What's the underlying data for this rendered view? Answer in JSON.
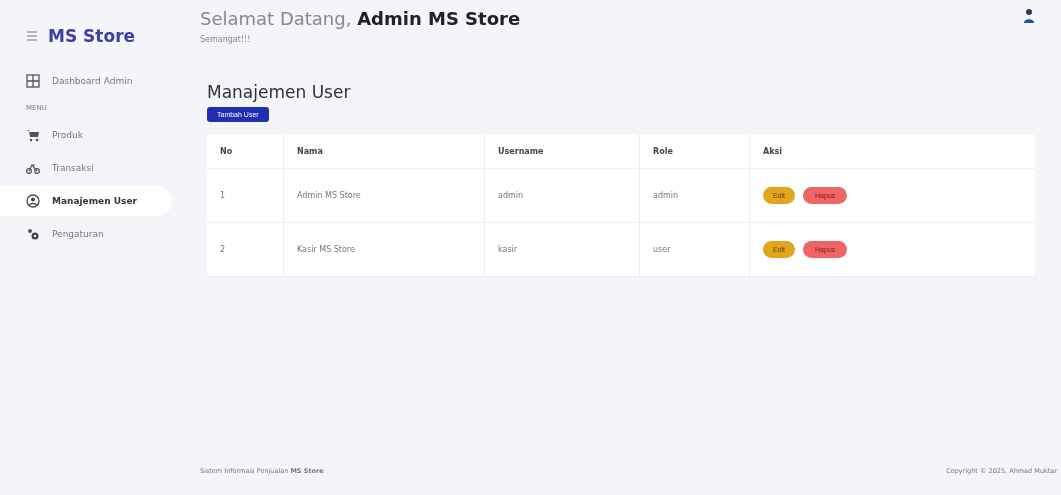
{
  "sidebar": {
    "brand": "MS Store",
    "dashboard": {
      "label": "Dashboard Admin",
      "selected": false
    },
    "section": "MENU",
    "items": [
      {
        "label": "Produk",
        "selected": false
      },
      {
        "label": "Transaksi",
        "selected": false
      },
      {
        "label": "Manajemen User",
        "selected": true
      },
      {
        "label": "Pengaturan",
        "selected": false
      }
    ]
  },
  "header": {
    "greeting": "Selamat Datang, ",
    "user": "Admin MS Store",
    "subtitle": "Semangat!!!"
  },
  "page": {
    "title": "Manajemen User",
    "add_button": "Tambah User"
  },
  "table": {
    "columns": [
      "No",
      "Nama",
      "Username",
      "Role",
      "Aksi"
    ],
    "rows": [
      {
        "no": "1",
        "name": "Admin MS Store",
        "username": "admin",
        "role": "admin",
        "actions": [
          "Edit",
          "Hapus"
        ]
      },
      {
        "no": "2",
        "name": "Kasir MS Store",
        "username": "kasir",
        "role": "user",
        "actions": [
          "Edit",
          "Hapus"
        ]
      }
    ]
  },
  "footer": {
    "left_prefix": "Sistem Informasi Penjualan ",
    "left_brand": "MS Store",
    "right": "Copyright © 2025, Ahmad Muktar"
  }
}
